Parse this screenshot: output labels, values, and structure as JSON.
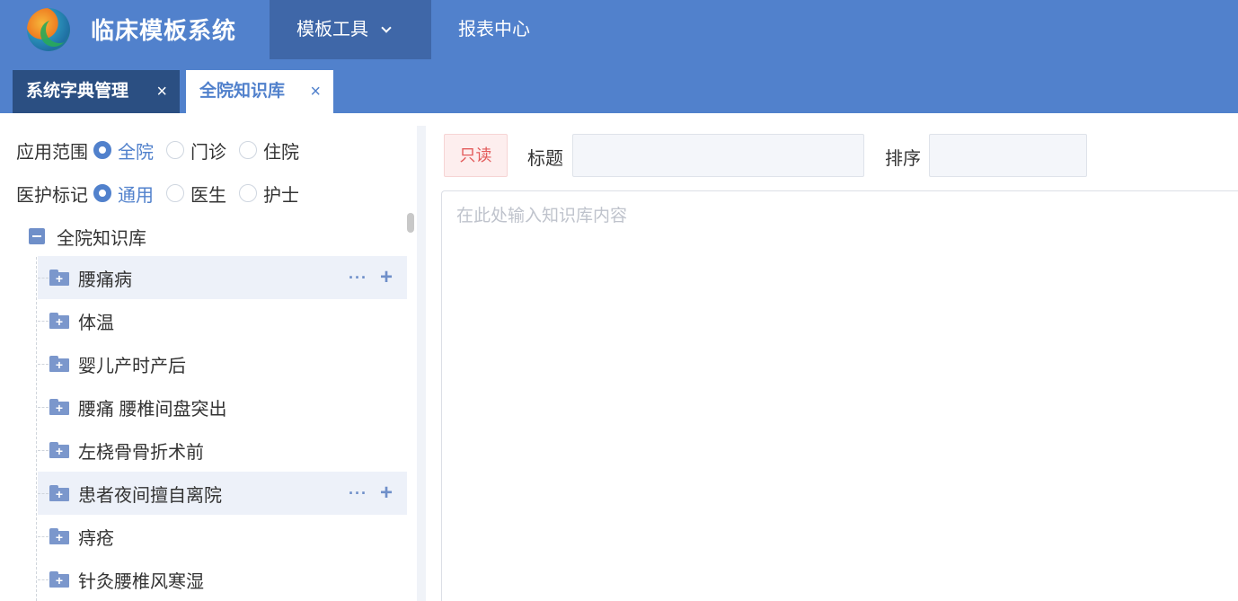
{
  "header": {
    "app_title": "临床模板系统",
    "nav": [
      {
        "label": "模板工具",
        "active": true,
        "icon": "chevron-down-icon"
      },
      {
        "label": "报表中心",
        "active": false
      }
    ],
    "colors": {
      "header_bg": "#5181cc",
      "active_nav_bg": "#3f67a8"
    }
  },
  "tabs": [
    {
      "label": "系统字典管理",
      "close": "×",
      "active": false
    },
    {
      "label": "全院知识库",
      "close": "×",
      "active": true
    }
  ],
  "filters": {
    "scope": {
      "label": "应用范围",
      "options": [
        "全院",
        "门诊",
        "住院"
      ],
      "selected": "全院"
    },
    "care": {
      "label": "医护标记",
      "options": [
        "通用",
        "医生",
        "护士"
      ],
      "selected": "通用"
    }
  },
  "tree": {
    "root": "全院知识库",
    "nodes": [
      {
        "label": "腰痛病",
        "highlighted": true
      },
      {
        "label": "体温",
        "highlighted": false
      },
      {
        "label": "婴儿产时产后",
        "highlighted": false
      },
      {
        "label": "腰痛 腰椎间盘突出",
        "highlighted": false
      },
      {
        "label": "左桡骨骨折术前",
        "highlighted": false
      },
      {
        "label": "患者夜间擅自离院",
        "highlighted": true
      },
      {
        "label": "痔疮",
        "highlighted": false
      },
      {
        "label": "针灸腰椎风寒湿",
        "highlighted": false
      }
    ],
    "more_label": "···",
    "add_label": "+"
  },
  "editor": {
    "readonly_label": "只读",
    "title_label": "标题",
    "title_value": "",
    "order_label": "排序",
    "order_value": "",
    "content_placeholder": "在此处输入知识库内容"
  }
}
